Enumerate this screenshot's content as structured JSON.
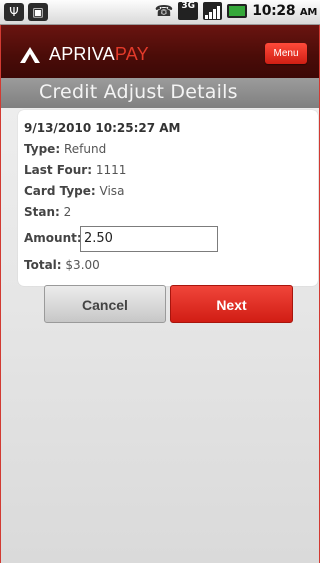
{
  "statusbar": {
    "time": "10:28",
    "ampm": "AM",
    "network_label": "3G"
  },
  "header": {
    "logo_part1": "APRIVA",
    "logo_part2": "PAY",
    "menu_label": "Menu"
  },
  "page": {
    "title": "Credit Adjust Details"
  },
  "details": {
    "timestamp": "9/13/2010 10:25:27 AM",
    "type_label": "Type:",
    "type_value": "Refund",
    "last_four_label": "Last Four:",
    "last_four_value": "1111",
    "card_type_label": "Card Type:",
    "card_type_value": "Visa",
    "stan_label": "Stan:",
    "stan_value": "2",
    "amount_label": "Amount:",
    "amount_value": "2.50",
    "total_label": "Total:",
    "total_value": "$3.00"
  },
  "actions": {
    "cancel_label": "Cancel",
    "next_label": "Next"
  },
  "colors": {
    "brand_red": "#e23a2a",
    "header_dark": "#4a0c08",
    "title_band": "#8c8c8c"
  }
}
